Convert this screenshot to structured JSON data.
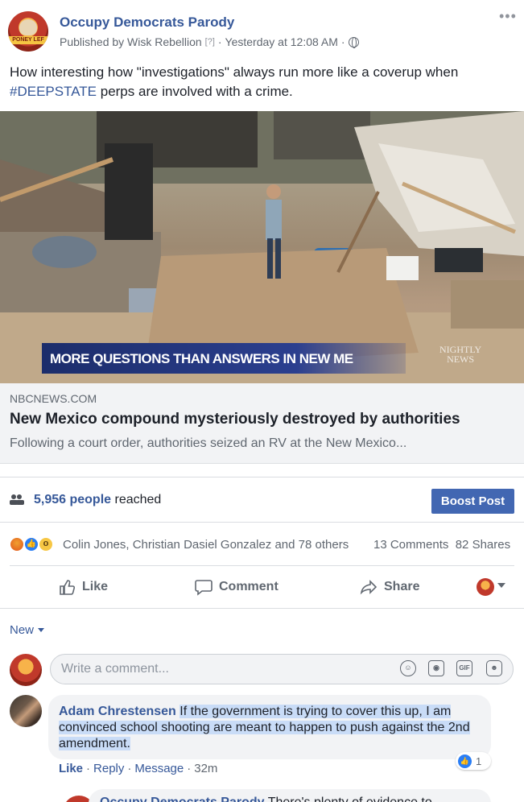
{
  "post": {
    "page_name": "Occupy Democrats Parody",
    "avatar_text": "PONEY LEF",
    "published_by": "Published by Wisk Rebellion",
    "help_marker": "[?]",
    "dot": "·",
    "time": "Yesterday at 12:08 AM",
    "more": "•••",
    "text_before": "How interesting how \"investigations\" always run more like a coverup when ",
    "hashtag": "#DEEPSTATE",
    "text_after": " perps are involved with a crime."
  },
  "image": {
    "banner": "MORE QUESTIONS THAN ANSWERS IN NEW ME",
    "logo_line1": "NIGHTLY",
    "logo_line2": "NEWS"
  },
  "link": {
    "domain": "NBCNEWS.COM",
    "title": "New Mexico compound mysteriously destroyed by authorities",
    "description": "Following a court order, authorities seized an RV at the New Mexico..."
  },
  "stats": {
    "reach_count": "5,956 people",
    "reach_suffix": " reached",
    "boost_label": "Boost Post",
    "reaction_names": "Colin Jones, Christian Dasiel Gonzalez and 78 others",
    "comments": "13 Comments",
    "shares": "82 Shares"
  },
  "actions": {
    "like": "Like",
    "comment": "Comment",
    "share": "Share"
  },
  "comments": {
    "sort": "New",
    "placeholder": "Write a comment...",
    "gif": "GIF",
    "items": [
      {
        "author": "Adam Chrestensen",
        "text": "If the government is trying to cover this up, I am convinced school shooting are meant to happen to push against the 2nd amendment.",
        "like": "Like",
        "reply": "Reply",
        "message": "Message",
        "time": "32m",
        "like_count": "1"
      }
    ],
    "peek_author": "Occupy Democrats Parody",
    "peek_text": "There's plenty of evidence to"
  },
  "colors": {
    "link": "#365899",
    "boost": "#4267b2",
    "like_blue": "#2a7ef5",
    "highlight": "#c9dcf7"
  }
}
